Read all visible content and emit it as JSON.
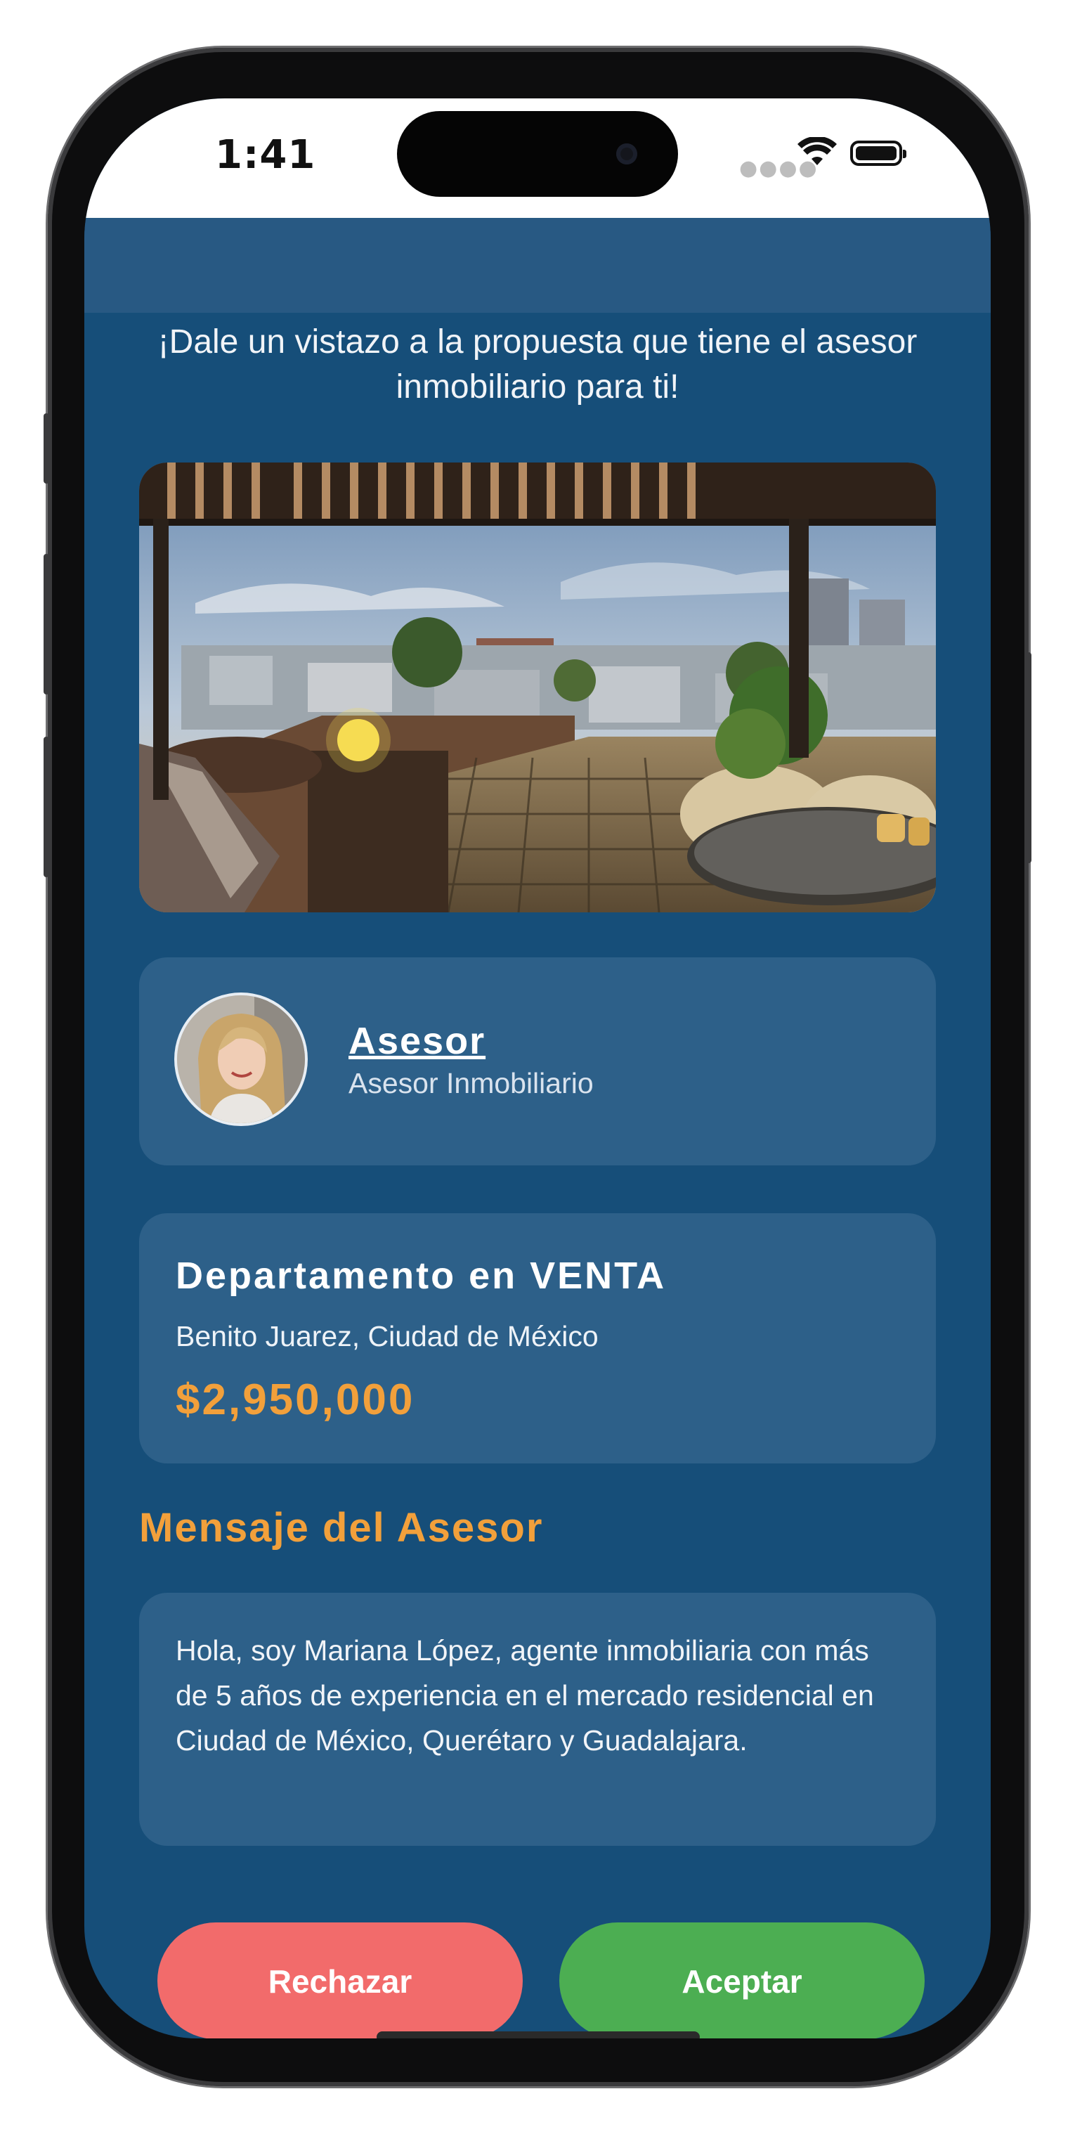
{
  "status_bar": {
    "time": "1:41"
  },
  "intro": {
    "text": "¡Dale un vistazo a la propuesta que tiene el asesor inmobiliario para ti!"
  },
  "advisor": {
    "name": "Asesor",
    "role": "Asesor Inmobiliario"
  },
  "property": {
    "title": "Departamento en VENTA",
    "location": "Benito Juarez, Ciudad de México",
    "price": "$2,950,000"
  },
  "message": {
    "heading": "Mensaje del Asesor",
    "body": "Hola, soy Mariana López, agente inmobiliaria con más de 5 años de experiencia en el mercado residencial en Ciudad de México, Querétaro y Guadalajara."
  },
  "actions": {
    "reject_label": "Rechazar",
    "accept_label": "Aceptar"
  },
  "colors": {
    "background": "#164e79",
    "card": "#2d6089",
    "accent": "#f2a03b",
    "reject": "#f26b6b",
    "accept": "#4cae52"
  }
}
